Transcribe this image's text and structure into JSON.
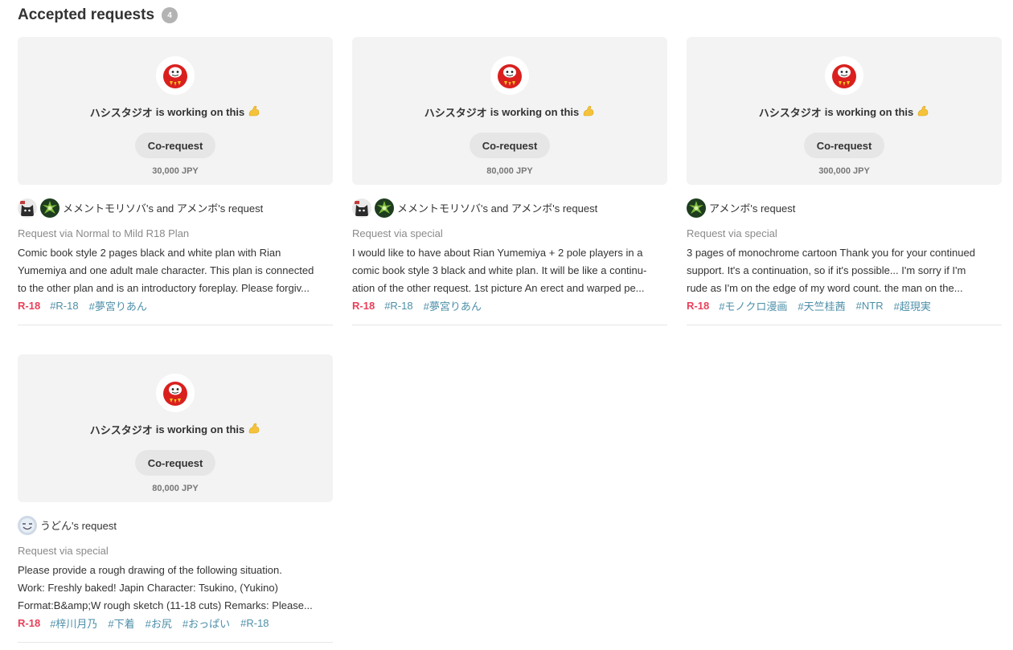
{
  "section": {
    "title": "Accepted requests",
    "count": "4"
  },
  "colors": {
    "r18": "#e8405a",
    "tag": "#4d8fa8",
    "card_bg": "#f3f3f3",
    "button_bg": "#e6e6e6"
  },
  "cards": [
    {
      "creator_name": "ハシスタジオ",
      "working_text": "is working on this",
      "emoji": "💪",
      "corequest_label": "Co-request",
      "price": "30,000 JPY",
      "requester_text": "メメントモリソバ's and アメンボ's request",
      "avatars": [
        "cat-avatar",
        "green-avatar"
      ],
      "plan": "Request via Normal to Mild R18 Plan",
      "desc_lines": [
        "Comic book style 2 pages black and white plan with Rian",
        "Yumemiya and one adult male character. This plan is connected",
        "to the other plan and is an introductory foreplay. Please forgiv..."
      ],
      "rating": "R-18",
      "tags": [
        "#R-18",
        "#夢宮りあん"
      ]
    },
    {
      "creator_name": "ハシスタジオ",
      "working_text": "is working on this",
      "emoji": "💪",
      "corequest_label": "Co-request",
      "price": "80,000 JPY",
      "requester_text": "メメントモリソバ's and アメンボ's request",
      "avatars": [
        "cat-avatar",
        "green-avatar"
      ],
      "plan": "Request via special",
      "desc_lines": [
        "I would like to have about Rian Yumemiya + 2 pole players in a",
        "comic book style 3 black and white plan. It will be like a continu-",
        "ation of the other request. 1st picture An erect and warped pe..."
      ],
      "rating": "R-18",
      "tags": [
        "#R-18",
        "#夢宮りあん"
      ]
    },
    {
      "creator_name": "ハシスタジオ",
      "working_text": "is working on this",
      "emoji": "💪",
      "corequest_label": "Co-request",
      "price": "300,000 JPY",
      "requester_text": "アメンボ's request",
      "avatars": [
        "green-avatar"
      ],
      "plan": "Request via special",
      "desc_lines": [
        "3 pages of monochrome cartoon Thank you for your continued",
        "support. It's a continuation, so if it's possible... I'm sorry if I'm",
        "rude as I'm on the edge of my word count. the man on the..."
      ],
      "rating": "R-18",
      "tags": [
        "#モノクロ漫画",
        "#天竺桂茜",
        "#NTR",
        "#超現実"
      ]
    },
    {
      "creator_name": "ハシスタジオ",
      "working_text": "is working on this",
      "emoji": "💪",
      "corequest_label": "Co-request",
      "price": "80,000 JPY",
      "requester_text": "うどん's request",
      "avatars": [
        "face-avatar"
      ],
      "plan": "Request via special",
      "desc_lines": [
        "Please provide a rough drawing of the following situation.",
        "Work: Freshly baked! Japin Character: Tsukino, (Yukino)",
        "Format:B&amp;W rough sketch (11-18 cuts) Remarks: Please..."
      ],
      "rating": "R-18",
      "tags": [
        "#梓川月乃",
        "#下着",
        "#お尻",
        "#おっぱい",
        "#R-18"
      ]
    }
  ]
}
